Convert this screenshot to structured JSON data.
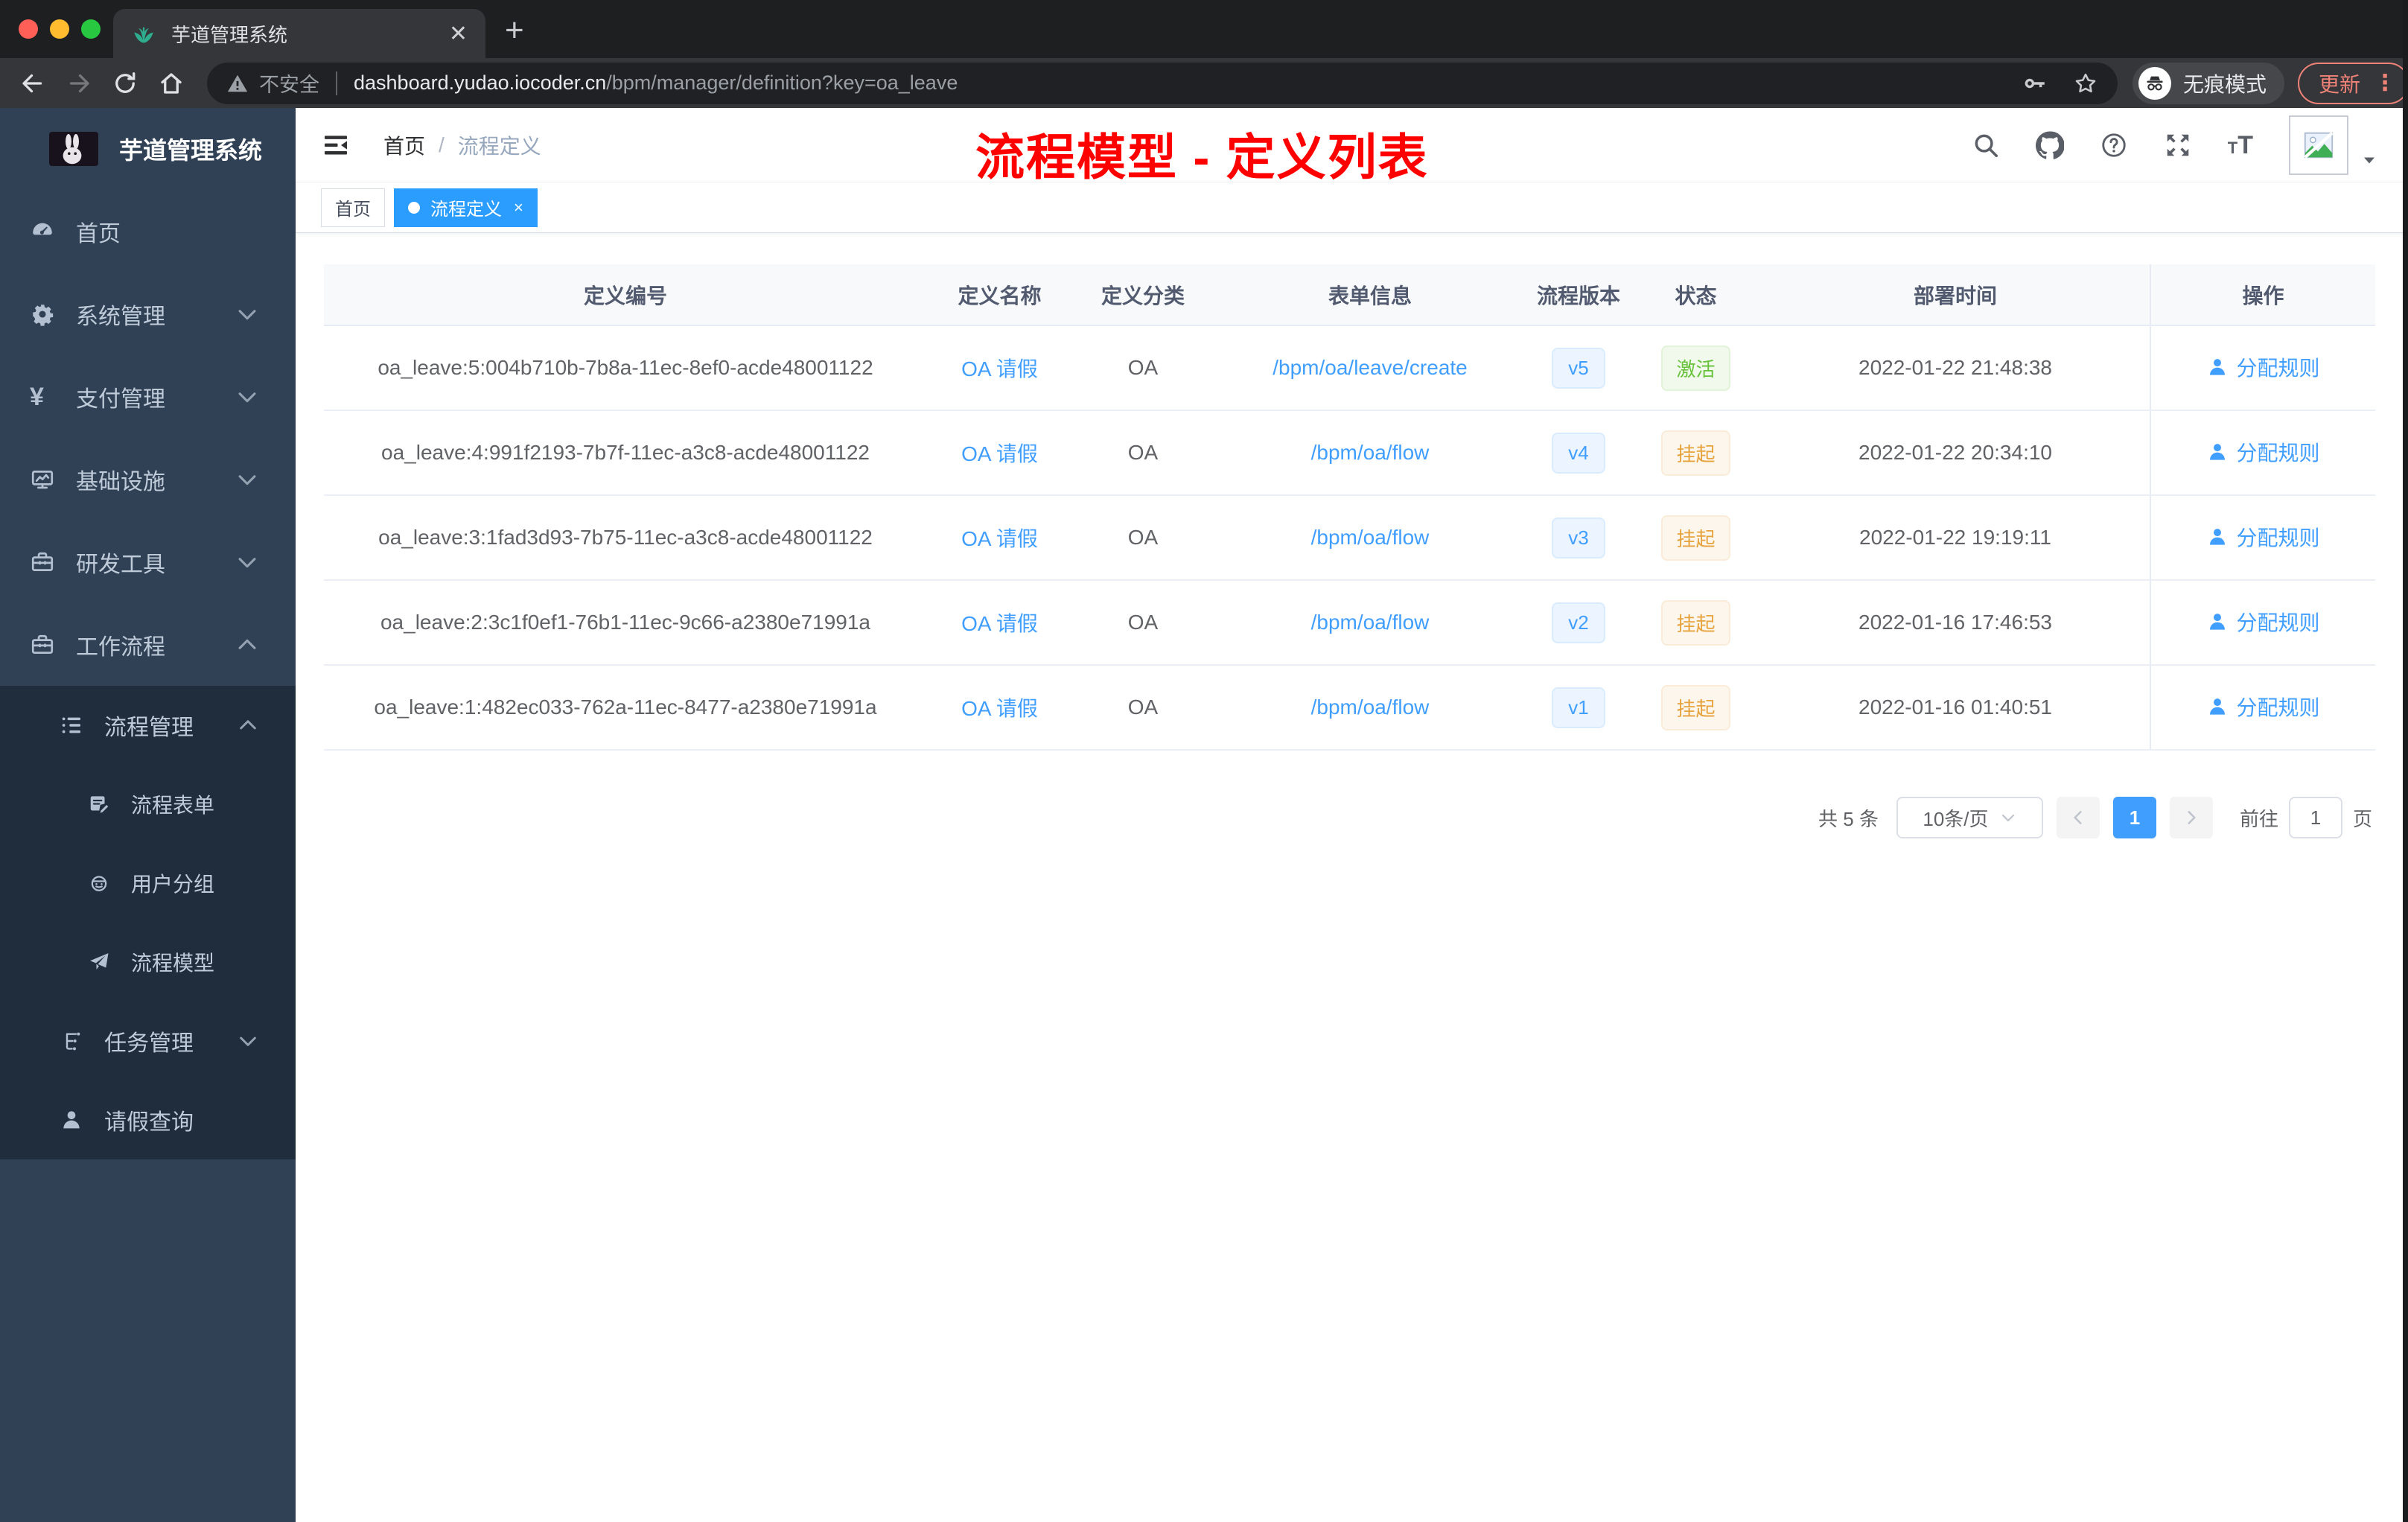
{
  "browser": {
    "tab": {
      "title": "芋道管理系统"
    },
    "toolbar": {
      "security": "不安全",
      "url_host": "dashboard.yudao.iocoder.cn",
      "url_path": "/bpm/manager/definition?key=oa_leave",
      "incognito": "无痕模式",
      "update": "更新",
      "menu_dots": "⋮",
      "new_tab": "+",
      "tab_close": "✕"
    }
  },
  "sidebar": {
    "title": "芋道管理系统",
    "items": [
      {
        "key": "home",
        "label": "首页",
        "icon": "dashboard",
        "level": 1,
        "arrow": "",
        "dark": false
      },
      {
        "key": "system",
        "label": "系统管理",
        "icon": "gear",
        "level": 1,
        "arrow": "down",
        "dark": false
      },
      {
        "key": "payment",
        "label": "支付管理",
        "icon": "yen",
        "level": 1,
        "arrow": "down",
        "dark": false
      },
      {
        "key": "infra",
        "label": "基础设施",
        "icon": "monitor",
        "level": 1,
        "arrow": "down",
        "dark": false
      },
      {
        "key": "devtools",
        "label": "研发工具",
        "icon": "toolbox",
        "level": 1,
        "arrow": "down",
        "dark": false
      },
      {
        "key": "workflow",
        "label": "工作流程",
        "icon": "toolbox",
        "level": 1,
        "arrow": "up",
        "dark": false
      },
      {
        "key": "process-mgmt",
        "label": "流程管理",
        "icon": "list",
        "level": 2,
        "arrow": "up",
        "dark": true
      },
      {
        "key": "process-form",
        "label": "流程表单",
        "icon": "form",
        "level": 3,
        "arrow": "",
        "dark": true
      },
      {
        "key": "user-group",
        "label": "用户分组",
        "icon": "group",
        "level": 3,
        "arrow": "",
        "dark": true
      },
      {
        "key": "process-model",
        "label": "流程模型",
        "icon": "plane",
        "level": 3,
        "arrow": "",
        "dark": true
      },
      {
        "key": "task-mgmt",
        "label": "任务管理",
        "icon": "tasks",
        "level": 2,
        "arrow": "down",
        "dark": true
      },
      {
        "key": "leave-query",
        "label": "请假查询",
        "icon": "user",
        "level": 2,
        "arrow": "",
        "dark": true
      }
    ]
  },
  "navbar": {
    "breadcrumb": [
      "首页",
      "流程定义"
    ]
  },
  "annotation": {
    "text": "流程模型 - 定义列表",
    "color": "#fe0000"
  },
  "tags": [
    {
      "label": "首页",
      "active": false
    },
    {
      "label": "流程定义",
      "active": true,
      "close": "×"
    }
  ],
  "table": {
    "columns": [
      "定义编号",
      "定义名称",
      "定义分类",
      "表单信息",
      "流程版本",
      "状态",
      "部署时间",
      "操作"
    ],
    "action_label": "分配规则",
    "rows": [
      {
        "id": "oa_leave:5:004b710b-7b8a-11ec-8ef0-acde48001122",
        "name": "OA 请假",
        "category": "OA",
        "form": "/bpm/oa/leave/create",
        "version": "v5",
        "status": "激活",
        "status_type": "success",
        "deployed": "2022-01-22 21:48:38"
      },
      {
        "id": "oa_leave:4:991f2193-7b7f-11ec-a3c8-acde48001122",
        "name": "OA 请假",
        "category": "OA",
        "form": "/bpm/oa/flow",
        "version": "v4",
        "status": "挂起",
        "status_type": "warning",
        "deployed": "2022-01-22 20:34:10"
      },
      {
        "id": "oa_leave:3:1fad3d93-7b75-11ec-a3c8-acde48001122",
        "name": "OA 请假",
        "category": "OA",
        "form": "/bpm/oa/flow",
        "version": "v3",
        "status": "挂起",
        "status_type": "warning",
        "deployed": "2022-01-22 19:19:11"
      },
      {
        "id": "oa_leave:2:3c1f0ef1-76b1-11ec-9c66-a2380e71991a",
        "name": "OA 请假",
        "category": "OA",
        "form": "/bpm/oa/flow",
        "version": "v2",
        "status": "挂起",
        "status_type": "warning",
        "deployed": "2022-01-16 17:46:53"
      },
      {
        "id": "oa_leave:1:482ec033-762a-11ec-8477-a2380e71991a",
        "name": "OA 请假",
        "category": "OA",
        "form": "/bpm/oa/flow",
        "version": "v1",
        "status": "挂起",
        "status_type": "warning",
        "deployed": "2022-01-16 01:40:51"
      }
    ]
  },
  "pagination": {
    "total": "共 5 条",
    "page_size": "10条/页",
    "current_page": "1",
    "goto_label": "前往",
    "goto_value": "1",
    "page_unit": "页"
  },
  "colors": {
    "accent": "#409eff",
    "tag_active": "#2b9dfe",
    "success": "#67c23a",
    "warning": "#e6a23c",
    "sidebar_bg": "#304156",
    "submenu_bg": "#1f2d3d",
    "annotation_red": "#fe0000"
  }
}
